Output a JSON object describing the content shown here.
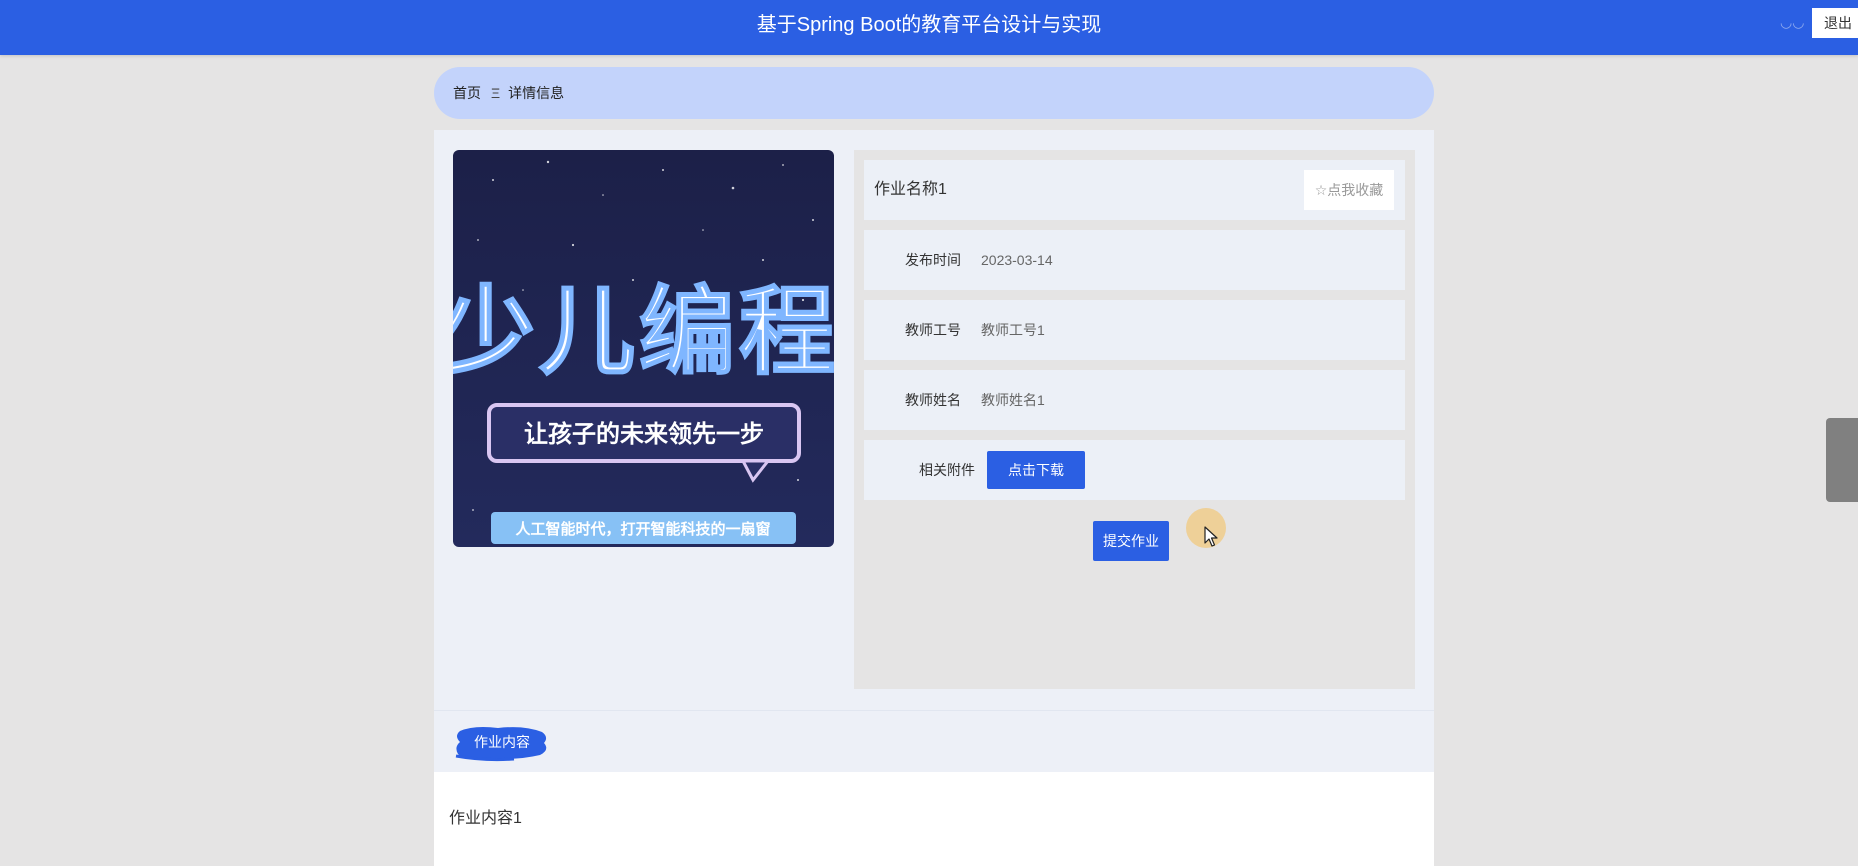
{
  "header": {
    "title": "基于Spring Boot的教育平台设计与实现",
    "user_icon": "user-icon",
    "logout_label": "退出"
  },
  "breadcrumb": {
    "home": "首页",
    "separator": "Ξ",
    "current": "详情信息"
  },
  "cover": {
    "headline": "少儿编程",
    "subtitle": "让孩子的未来领先一步",
    "tagline": "人工智能时代，打开智能科技的一扇窗"
  },
  "detail": {
    "name": "作业名称1",
    "favorite_label": "☆点我收藏",
    "fields": [
      {
        "label": "发布时间",
        "value": "2023-03-14"
      },
      {
        "label": "教师工号",
        "value": "教师工号1"
      },
      {
        "label": "教师姓名",
        "value": "教师姓名1"
      }
    ],
    "attachment_label": "相关附件",
    "download_label": "点击下载",
    "submit_label": "提交作业"
  },
  "section": {
    "tab_label": "作业内容",
    "content": "作业内容1"
  },
  "colors": {
    "primary": "#2b5fe3",
    "breadcrumb_bg": "#c3d3fb",
    "panel_bg": "#edf0f7",
    "page_bg": "#e5e4e4"
  }
}
